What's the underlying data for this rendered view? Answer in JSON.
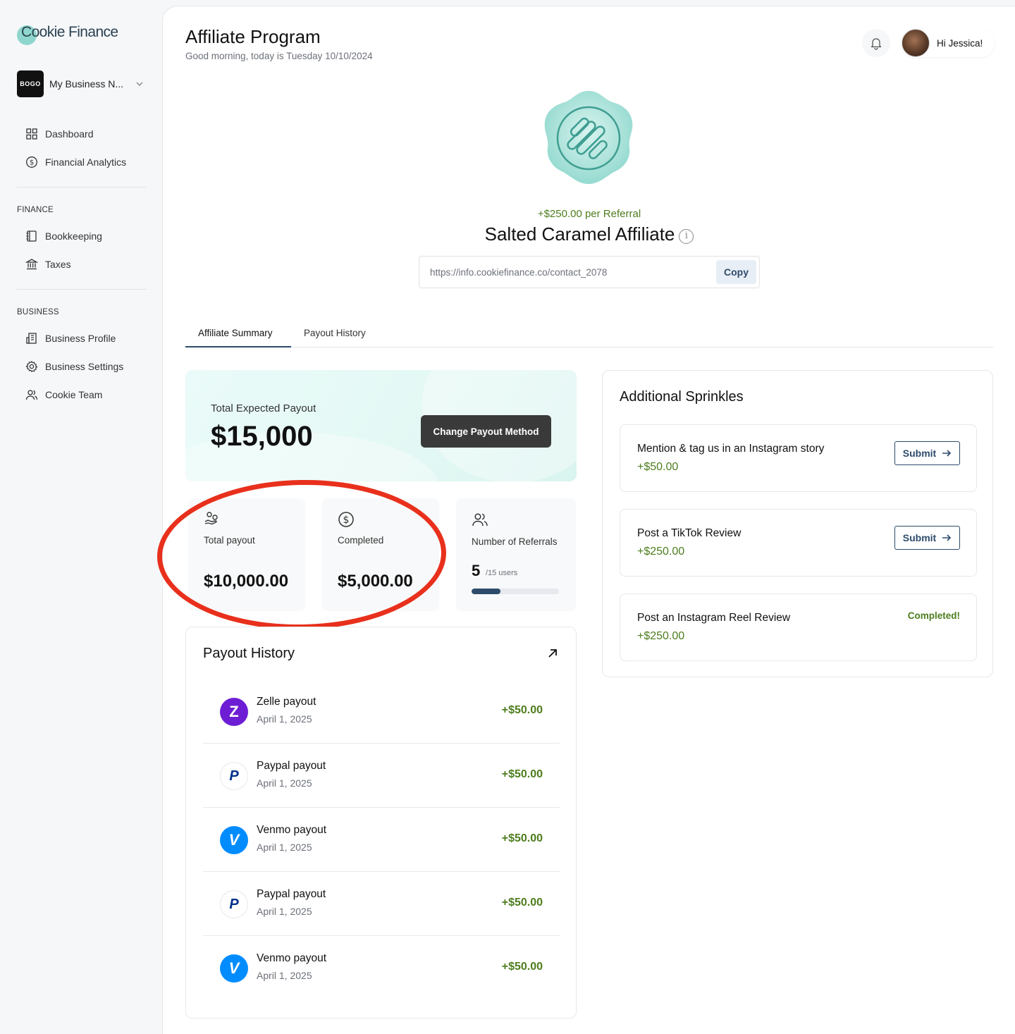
{
  "brand": {
    "name": "Cookie Finance"
  },
  "business": {
    "name": "My Business N...",
    "logo_text": "BOGO"
  },
  "sidebar": {
    "top_items": [
      {
        "label": "Dashboard",
        "icon": "grid-icon"
      },
      {
        "label": "Financial Analytics",
        "icon": "dollar-circle-icon"
      }
    ],
    "finance_label": "FINANCE",
    "finance_items": [
      {
        "label": "Bookkeeping",
        "icon": "book-icon"
      },
      {
        "label": "Taxes",
        "icon": "bank-icon"
      }
    ],
    "business_label": "BUSINESS",
    "business_items": [
      {
        "label": "Business Profile",
        "icon": "building-icon"
      },
      {
        "label": "Business Settings",
        "icon": "gear-icon"
      },
      {
        "label": "Cookie Team",
        "icon": "users-icon"
      }
    ]
  },
  "header": {
    "title": "Affiliate Program",
    "greeting": "Good morning, today is Tuesday 10/10/2024",
    "user_greeting": "Hi Jessica!"
  },
  "affiliate": {
    "per_referral": "+$250.00 per Referral",
    "title": "Salted Caramel Affiliate",
    "link": "https://info.cookiefinance.co/contact_2078",
    "copy_label": "Copy"
  },
  "tabs": [
    {
      "label": "Affiliate Summary",
      "active": true
    },
    {
      "label": "Payout History",
      "active": false
    }
  ],
  "summary": {
    "total_label": "Total Expected Payout",
    "total_value": "$15,000",
    "change_button": "Change Payout Method",
    "stats": [
      {
        "label": "Total payout",
        "value": "$10,000.00",
        "icon": "hand-coins-icon"
      },
      {
        "label": "Completed",
        "value": "$5,000.00",
        "icon": "dollar-circle-icon"
      }
    ],
    "referrals": {
      "label": "Number of Referrals",
      "count": "5",
      "total": "/15 users",
      "progress": 0.3333
    }
  },
  "history": {
    "title": "Payout History",
    "rows": [
      {
        "name": "Zelle payout",
        "date": "April 1, 2025",
        "amount": "+$50.00",
        "provider": "zelle",
        "glyph": "Z",
        "color": "#6d1ed4"
      },
      {
        "name": "Paypal payout",
        "date": "April 1, 2025",
        "amount": "+$50.00",
        "provider": "paypal",
        "glyph": "P",
        "color": "#ffffff"
      },
      {
        "name": "Venmo payout",
        "date": "April 1, 2025",
        "amount": "+$50.00",
        "provider": "venmo",
        "glyph": "V",
        "color": "#008cff"
      },
      {
        "name": "Paypal payout",
        "date": "April 1, 2025",
        "amount": "+$50.00",
        "provider": "paypal",
        "glyph": "P",
        "color": "#ffffff"
      },
      {
        "name": "Venmo payout",
        "date": "April 1, 2025",
        "amount": "+$50.00",
        "provider": "venmo",
        "glyph": "V",
        "color": "#008cff"
      }
    ]
  },
  "sprinkles": {
    "title": "Additional Sprinkles",
    "tasks": [
      {
        "name": "Mention & tag us in an Instagram story",
        "reward": "+$50.00",
        "action": "Submit",
        "completed": false
      },
      {
        "name": "Post a TikTok Review",
        "reward": "+$250.00",
        "action": "Submit",
        "completed": false
      },
      {
        "name": "Post an Instagram Reel Review",
        "reward": "+$250.00",
        "status": "Completed!",
        "completed": true
      }
    ]
  },
  "colors": {
    "accent": "#2d4b6b",
    "positive": "#4d7d1e",
    "highlight_circle": "#e8301c",
    "mint": "#8ed6cd"
  }
}
